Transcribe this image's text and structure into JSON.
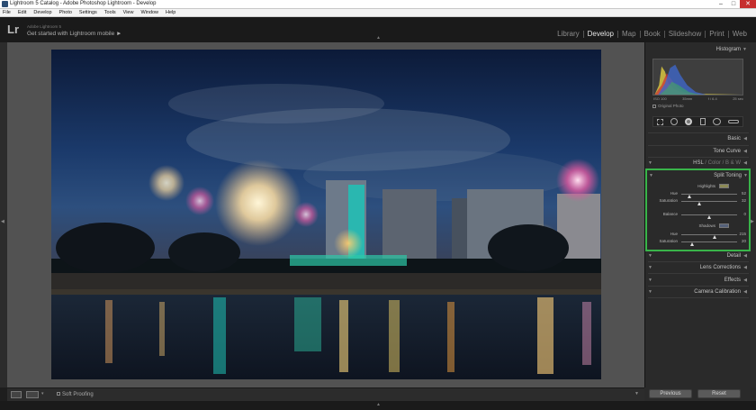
{
  "window": {
    "title": "Lightroom 5 Catalog - Adobe Photoshop Lightroom - Develop",
    "minimize_glyph": "–",
    "maximize_glyph": "□",
    "close_glyph": "✕"
  },
  "menu": [
    "File",
    "Edit",
    "Develop",
    "Photo",
    "Settings",
    "Tools",
    "View",
    "Window",
    "Help"
  ],
  "identity": {
    "logo": "Lr",
    "product": "Adobe Lightroom 5",
    "mobile_prompt": "Get started with Lightroom mobile ►"
  },
  "modules": [
    {
      "label": "Library",
      "active": false
    },
    {
      "label": "Develop",
      "active": true
    },
    {
      "label": "Map",
      "active": false
    },
    {
      "label": "Book",
      "active": false
    },
    {
      "label": "Slideshow",
      "active": false
    },
    {
      "label": "Print",
      "active": false
    },
    {
      "label": "Web",
      "active": false
    }
  ],
  "histogram": {
    "title": "Histogram",
    "iso": "ISO 100",
    "focal": "35mm",
    "aperture": "f / 6.4",
    "shutter": "25 sec",
    "original_photo": "Original Photo"
  },
  "panels": {
    "basic": "Basic",
    "tone_curve": "Tone Curve",
    "hsl": "HSL",
    "hsl_sep": "/",
    "color": "Color",
    "bw": "B & W",
    "split_toning": "Split Toning",
    "detail": "Detail",
    "lens": "Lens Corrections",
    "effects": "Effects",
    "camera": "Camera Calibration"
  },
  "split_toning": {
    "highlights_label": "Highlights",
    "highlights_color": "#8c8a55",
    "hue_label": "Hue",
    "hue_high": "52",
    "hue_high_frac": 0.144,
    "saturation_label": "Saturation",
    "sat_high": "32",
    "sat_high_frac": 0.32,
    "balance_label": "Balance",
    "balance": "0",
    "balance_frac": 0.5,
    "shadows_label": "Shadows",
    "shadows_color": "#55617a",
    "hue_shadow": "215",
    "hue_shadow_frac": 0.597,
    "sat_shadow": "20",
    "sat_shadow_frac": 0.2
  },
  "bottom": {
    "soft_proofing": "Soft Proofing",
    "previous": "Previous",
    "reset": "Reset"
  },
  "colors": {
    "accent_highlight_box": "#39b54a",
    "panel_bg": "#2a2a2a",
    "workspace_bg": "#525252"
  }
}
